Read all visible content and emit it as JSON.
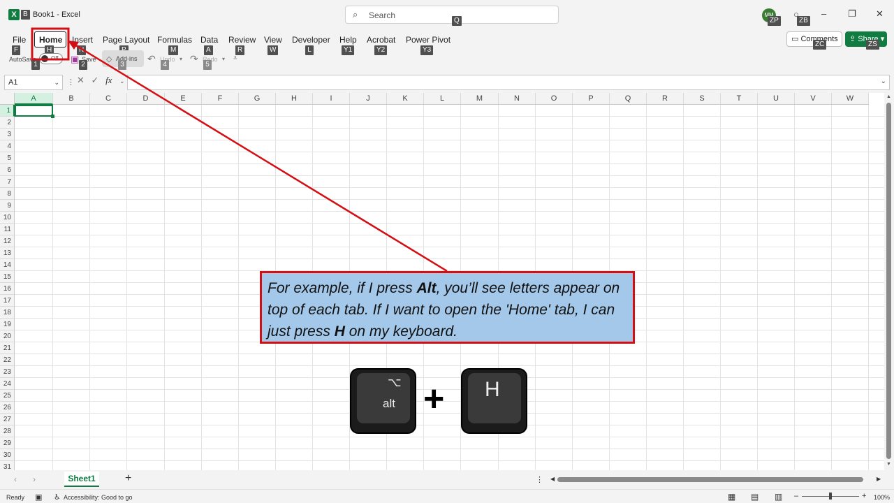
{
  "window": {
    "app_badge": "X",
    "doc_keytip": "B",
    "title": "Book1  -  Excel",
    "search_placeholder": "Search",
    "search_keytip": "Q",
    "avatar_initials": "MM",
    "avatar_keytip": "ZP",
    "lightbulb_keytip": "ZB",
    "minimize": "–",
    "restore": "❐",
    "close": "✕"
  },
  "tabs": [
    {
      "label": "File",
      "keytip": "F"
    },
    {
      "label": "Home",
      "keytip": "H"
    },
    {
      "label": "Insert",
      "keytip": "N"
    },
    {
      "label": "Page Layout",
      "keytip": "P"
    },
    {
      "label": "Formulas",
      "keytip": "M"
    },
    {
      "label": "Data",
      "keytip": "A"
    },
    {
      "label": "Review",
      "keytip": "R"
    },
    {
      "label": "View",
      "keytip": "W"
    },
    {
      "label": "Developer",
      "keytip": "L"
    },
    {
      "label": "Help",
      "keytip": "Y1"
    },
    {
      "label": "Acrobat",
      "keytip": "Y2"
    },
    {
      "label": "Power Pivot",
      "keytip": "Y3"
    }
  ],
  "ribbon_right": {
    "comments_label": "Comments",
    "comments_keytip": "ZC",
    "share_label": "Share",
    "share_keytip": "ZS"
  },
  "qat": {
    "autosave_label": "AutoSave",
    "autosave_state": "Off",
    "autosave_keytip": "1",
    "save_label": "Save",
    "save_keytip": "2",
    "addins_label": "Add-ins",
    "addins_keytip": "3",
    "undo_label": "Undo",
    "undo_keytip": "4",
    "redo_label": "Redo",
    "redo_keytip": "5"
  },
  "formula_bar": {
    "name_box": "A1",
    "fx": "fx",
    "formula_value": ""
  },
  "grid": {
    "columns": [
      "A",
      "B",
      "C",
      "D",
      "E",
      "F",
      "G",
      "H",
      "I",
      "J",
      "K",
      "L",
      "M",
      "N",
      "O",
      "P",
      "Q",
      "R",
      "S",
      "T",
      "U",
      "V",
      "W"
    ],
    "rows": [
      "1",
      "2",
      "3",
      "4",
      "5",
      "6",
      "7",
      "8",
      "9",
      "10",
      "11",
      "12",
      "13",
      "14",
      "15",
      "16",
      "17",
      "18",
      "19",
      "20",
      "21",
      "22",
      "23",
      "24",
      "25",
      "26",
      "27",
      "28",
      "29",
      "30",
      "31"
    ],
    "active_cell": "A1"
  },
  "sheets": {
    "active": "Sheet1",
    "add": "+"
  },
  "status": {
    "ready": "Ready",
    "accessibility": "Accessibility: Good to go",
    "zoom_minus": "–",
    "zoom_plus": "+",
    "zoom": "100%"
  },
  "callout": {
    "t1": "For example, if I press ",
    "b1": "Alt",
    "t2": ", you’ll see letters appear on top of each tab. If I want to open the 'Home' tab, I can just press ",
    "b2": "H",
    "t3": " on my keyboard."
  },
  "keys": {
    "alt_symbol": "⌥",
    "alt_label": "alt",
    "plus": "+",
    "h_label": "H"
  },
  "colors": {
    "accent": "#107c41",
    "annotation_red": "#d40f14",
    "callout_fill": "#a4c8ea"
  }
}
